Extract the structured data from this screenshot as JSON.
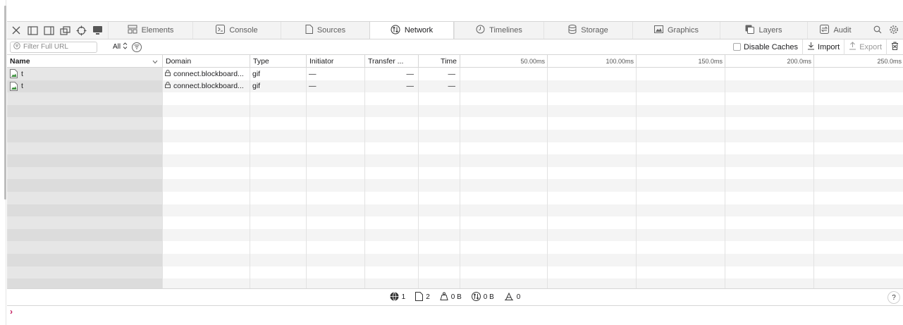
{
  "tabs": [
    {
      "label": "Elements",
      "icon": "elements-icon",
      "active": false
    },
    {
      "label": "Console",
      "icon": "console-icon",
      "active": false
    },
    {
      "label": "Sources",
      "icon": "sources-icon",
      "active": false
    },
    {
      "label": "Network",
      "icon": "network-icon",
      "active": true
    },
    {
      "label": "Timelines",
      "icon": "timelines-icon",
      "active": false
    },
    {
      "label": "Storage",
      "icon": "storage-icon",
      "active": false
    },
    {
      "label": "Graphics",
      "icon": "graphics-icon",
      "active": false
    },
    {
      "label": "Layers",
      "icon": "layers-icon",
      "active": false
    },
    {
      "label": "Audit",
      "icon": "audit-icon",
      "active": false
    }
  ],
  "filter": {
    "placeholder": "Filter Full URL",
    "type_label": "All"
  },
  "toolbar": {
    "disable_caches": "Disable Caches",
    "import": "Import",
    "export": "Export"
  },
  "columns": {
    "name": "Name",
    "domain": "Domain",
    "type": "Type",
    "initiator": "Initiator",
    "transfer": "Transfer ...",
    "time": "Time"
  },
  "ticks": [
    "50.00ms",
    "100.00ms",
    "150.0ms",
    "200.0ms",
    "250.0ms"
  ],
  "rows": [
    {
      "name": "t",
      "domain": "connect.blockboard...",
      "type": "gif",
      "initiator": "—",
      "transfer": "—",
      "time": "—"
    },
    {
      "name": "t",
      "domain": "connect.blockboard...",
      "type": "gif",
      "initiator": "—",
      "transfer": "—",
      "time": "—"
    }
  ],
  "status": {
    "domains": "1",
    "resources": "2",
    "transferred": "0 B",
    "size": "0 B",
    "time": "0"
  },
  "console_prompt": "›",
  "help_label": "?"
}
